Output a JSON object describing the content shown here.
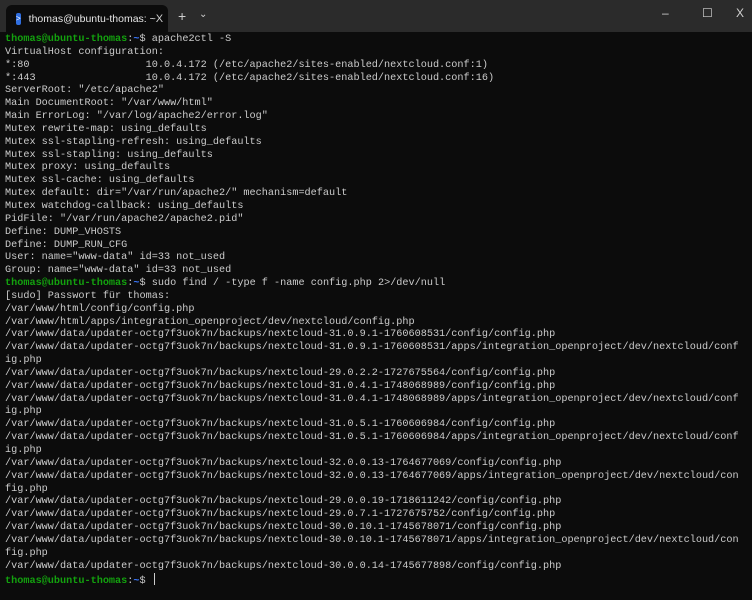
{
  "window": {
    "tab_title": "thomas@ubuntu-thomas: ~",
    "tab_close": "X",
    "new_tab": "+",
    "dropdown": "⌄",
    "minimize": "–",
    "maximize": "☐",
    "close": "X"
  },
  "prompt": {
    "user_host": "thomas@ubuntu-thomas",
    "sep": ":",
    "path": "~",
    "symbol": "$ "
  },
  "blocks": [
    {
      "command": "apache2ctl -S",
      "output": [
        "VirtualHost configuration:",
        "*:80                   10.0.4.172 (/etc/apache2/sites-enabled/nextcloud.conf:1)",
        "*:443                  10.0.4.172 (/etc/apache2/sites-enabled/nextcloud.conf:16)",
        "ServerRoot: \"/etc/apache2\"",
        "Main DocumentRoot: \"/var/www/html\"",
        "Main ErrorLog: \"/var/log/apache2/error.log\"",
        "Mutex rewrite-map: using_defaults",
        "Mutex ssl-stapling-refresh: using_defaults",
        "Mutex ssl-stapling: using_defaults",
        "Mutex proxy: using_defaults",
        "Mutex ssl-cache: using_defaults",
        "Mutex default: dir=\"/var/run/apache2/\" mechanism=default",
        "Mutex watchdog-callback: using_defaults",
        "PidFile: \"/var/run/apache2/apache2.pid\"",
        "Define: DUMP_VHOSTS",
        "Define: DUMP_RUN_CFG",
        "User: name=\"www-data\" id=33 not_used",
        "Group: name=\"www-data\" id=33 not_used"
      ]
    },
    {
      "command": "sudo find / -type f -name config.php 2>/dev/null",
      "output": [
        "[sudo] Passwort für thomas:",
        "/var/www/html/config/config.php",
        "/var/www/html/apps/integration_openproject/dev/nextcloud/config.php",
        "/var/www/data/updater-octg7f3uok7n/backups/nextcloud-31.0.9.1-1760608531/config/config.php",
        "/var/www/data/updater-octg7f3uok7n/backups/nextcloud-31.0.9.1-1760608531/apps/integration_openproject/dev/nextcloud/conf",
        "ig.php",
        "/var/www/data/updater-octg7f3uok7n/backups/nextcloud-29.0.2.2-1727675564/config/config.php",
        "/var/www/data/updater-octg7f3uok7n/backups/nextcloud-31.0.4.1-1748068989/config/config.php",
        "/var/www/data/updater-octg7f3uok7n/backups/nextcloud-31.0.4.1-1748068989/apps/integration_openproject/dev/nextcloud/conf",
        "ig.php",
        "/var/www/data/updater-octg7f3uok7n/backups/nextcloud-31.0.5.1-1760606984/config/config.php",
        "/var/www/data/updater-octg7f3uok7n/backups/nextcloud-31.0.5.1-1760606984/apps/integration_openproject/dev/nextcloud/conf",
        "ig.php",
        "/var/www/data/updater-octg7f3uok7n/backups/nextcloud-32.0.0.13-1764677069/config/config.php",
        "/var/www/data/updater-octg7f3uok7n/backups/nextcloud-32.0.0.13-1764677069/apps/integration_openproject/dev/nextcloud/con",
        "fig.php",
        "/var/www/data/updater-octg7f3uok7n/backups/nextcloud-29.0.0.19-1718611242/config/config.php",
        "/var/www/data/updater-octg7f3uok7n/backups/nextcloud-29.0.7.1-1727675752/config/config.php",
        "/var/www/data/updater-octg7f3uok7n/backups/nextcloud-30.0.10.1-1745678071/config/config.php",
        "/var/www/data/updater-octg7f3uok7n/backups/nextcloud-30.0.10.1-1745678071/apps/integration_openproject/dev/nextcloud/con",
        "fig.php",
        "/var/www/data/updater-octg7f3uok7n/backups/nextcloud-30.0.0.14-1745677898/config/config.php"
      ]
    },
    {
      "command": "",
      "output": []
    }
  ]
}
